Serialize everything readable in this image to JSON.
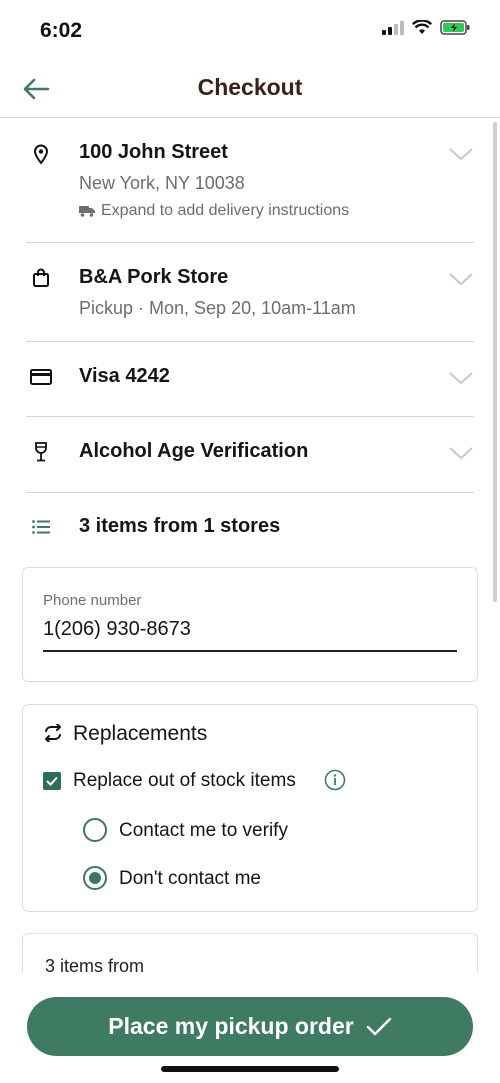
{
  "status_bar": {
    "time": "6:02"
  },
  "header": {
    "title": "Checkout"
  },
  "address": {
    "title": "100 John Street",
    "subtitle": "New York, NY 10038",
    "note": "Expand to add delivery instructions"
  },
  "store": {
    "title": "B&A Pork Store",
    "subtitle": "Pickup · Mon, Sep 20, 10am-11am"
  },
  "payment": {
    "title": "Visa 4242"
  },
  "alcohol": {
    "title": "Alcohol Age Verification"
  },
  "items": {
    "title": "3 items from 1 stores"
  },
  "phone": {
    "label": "Phone number",
    "value": "1(206) 930-8673"
  },
  "replacements": {
    "title": "Replacements",
    "checkbox_label": "Replace out of stock items",
    "checked": true,
    "options": [
      {
        "label": "Contact me to verify",
        "selected": false
      },
      {
        "label": "Don't contact me",
        "selected": true
      }
    ]
  },
  "summary_peek": {
    "text": "3 items from"
  },
  "cta": {
    "label": "Place my pickup order"
  },
  "colors": {
    "accent": "#3f7a62",
    "title": "#3b1f1a",
    "muted": "#6d6d6d"
  },
  "icons": [
    "back-arrow-icon",
    "location-pin-icon",
    "truck-icon",
    "shopping-bag-icon",
    "credit-card-icon",
    "wine-glass-icon",
    "list-icon",
    "chevron-down-icon",
    "swap-icon",
    "info-icon",
    "checkmark-icon"
  ]
}
